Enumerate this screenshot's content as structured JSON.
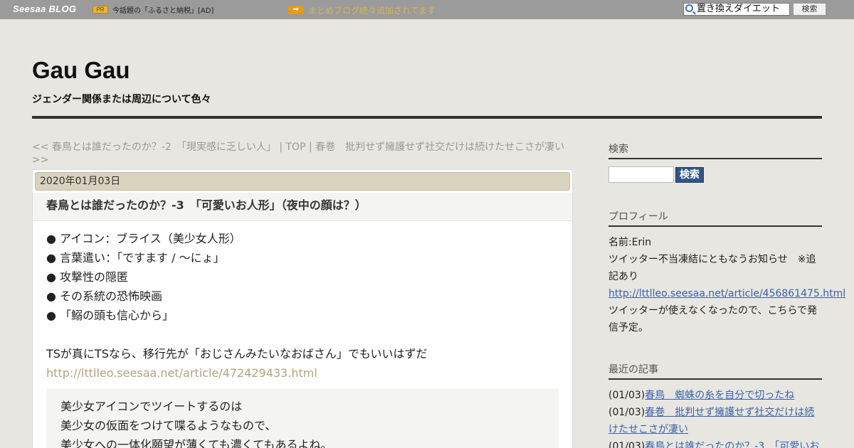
{
  "topbar": {
    "logo": "Seesaa BLOG",
    "pr_badge": "PR",
    "pr_text": "今話題の「ふるさと納税」[AD]",
    "arrow": "➡",
    "notice": "まとめブログ続々追加されてます",
    "search_value": "置き換えダイエット",
    "search_button": "検索"
  },
  "header": {
    "title": "Gau Gau",
    "description": "ジェンダー関係または周辺について色々"
  },
  "nav": {
    "prev": "<< 春鳥とは誰だったのか？-2　「現実感に乏しい人」",
    "sep1": " | ",
    "top": "TOP",
    "sep2": " | ",
    "next": "春巻　批判せず擁護せず社交だけは続けたせこさが凄い >>"
  },
  "article": {
    "date": "2020年01月03日",
    "title": "春鳥とは誰だったのか？-3　「可愛いお人形」（夜中の顔は？）",
    "bullets": [
      "● アイコン：ブライス（美少女人形）",
      "● 言葉遣い：「ですます / ～にょ」",
      "● 攻撃性の隠匿",
      "● その系統の恐怖映画",
      "● 「鰯の頭も信心から」"
    ],
    "paragraph": "TSが真にTSなら、移行先が「おじさんみたいなおばさん」でもいいはずだ",
    "link": "http://lttlleo.seesaa.net/article/472429433.html",
    "quote_lines": [
      "美少女アイコンでツイートするのは",
      "美少女の仮面をつけて喋るようなもので、",
      "美少女への一体化願望が薄くても濃くてもあるよね。"
    ]
  },
  "sidebar": {
    "search_heading": "検索",
    "search_button": "検索",
    "profile_heading": "プロフィール",
    "profile_name": "名前:Erin",
    "profile_text1": "ツイッター不当凍結にともなうお知らせ　※追記あり",
    "profile_link": "http://lttlleo.seesaa.net/article/456861475.html",
    "profile_text2": "ツイッターが使えなくなったので、こちらで発信予定。",
    "recent_heading": "最近の記事",
    "recent": [
      {
        "date": "(01/03)",
        "title": "春鳥　蜘蛛の糸を自分で切ったね"
      },
      {
        "date": "(01/03)",
        "title": "春巻　批判せず擁護せず社交だけは続けたせこさが凄い"
      },
      {
        "date": "(01/03)",
        "title": "春鳥とは誰だったのか？-3　「可愛いお"
      }
    ]
  },
  "colors": {
    "topbar": "#9b9b9b",
    "page_bg": "#e8e6e1",
    "date_bar": "#d8d3bf",
    "link": "#3a62a8",
    "article_link": "#b7a27e",
    "search_button": "#2f5687"
  }
}
